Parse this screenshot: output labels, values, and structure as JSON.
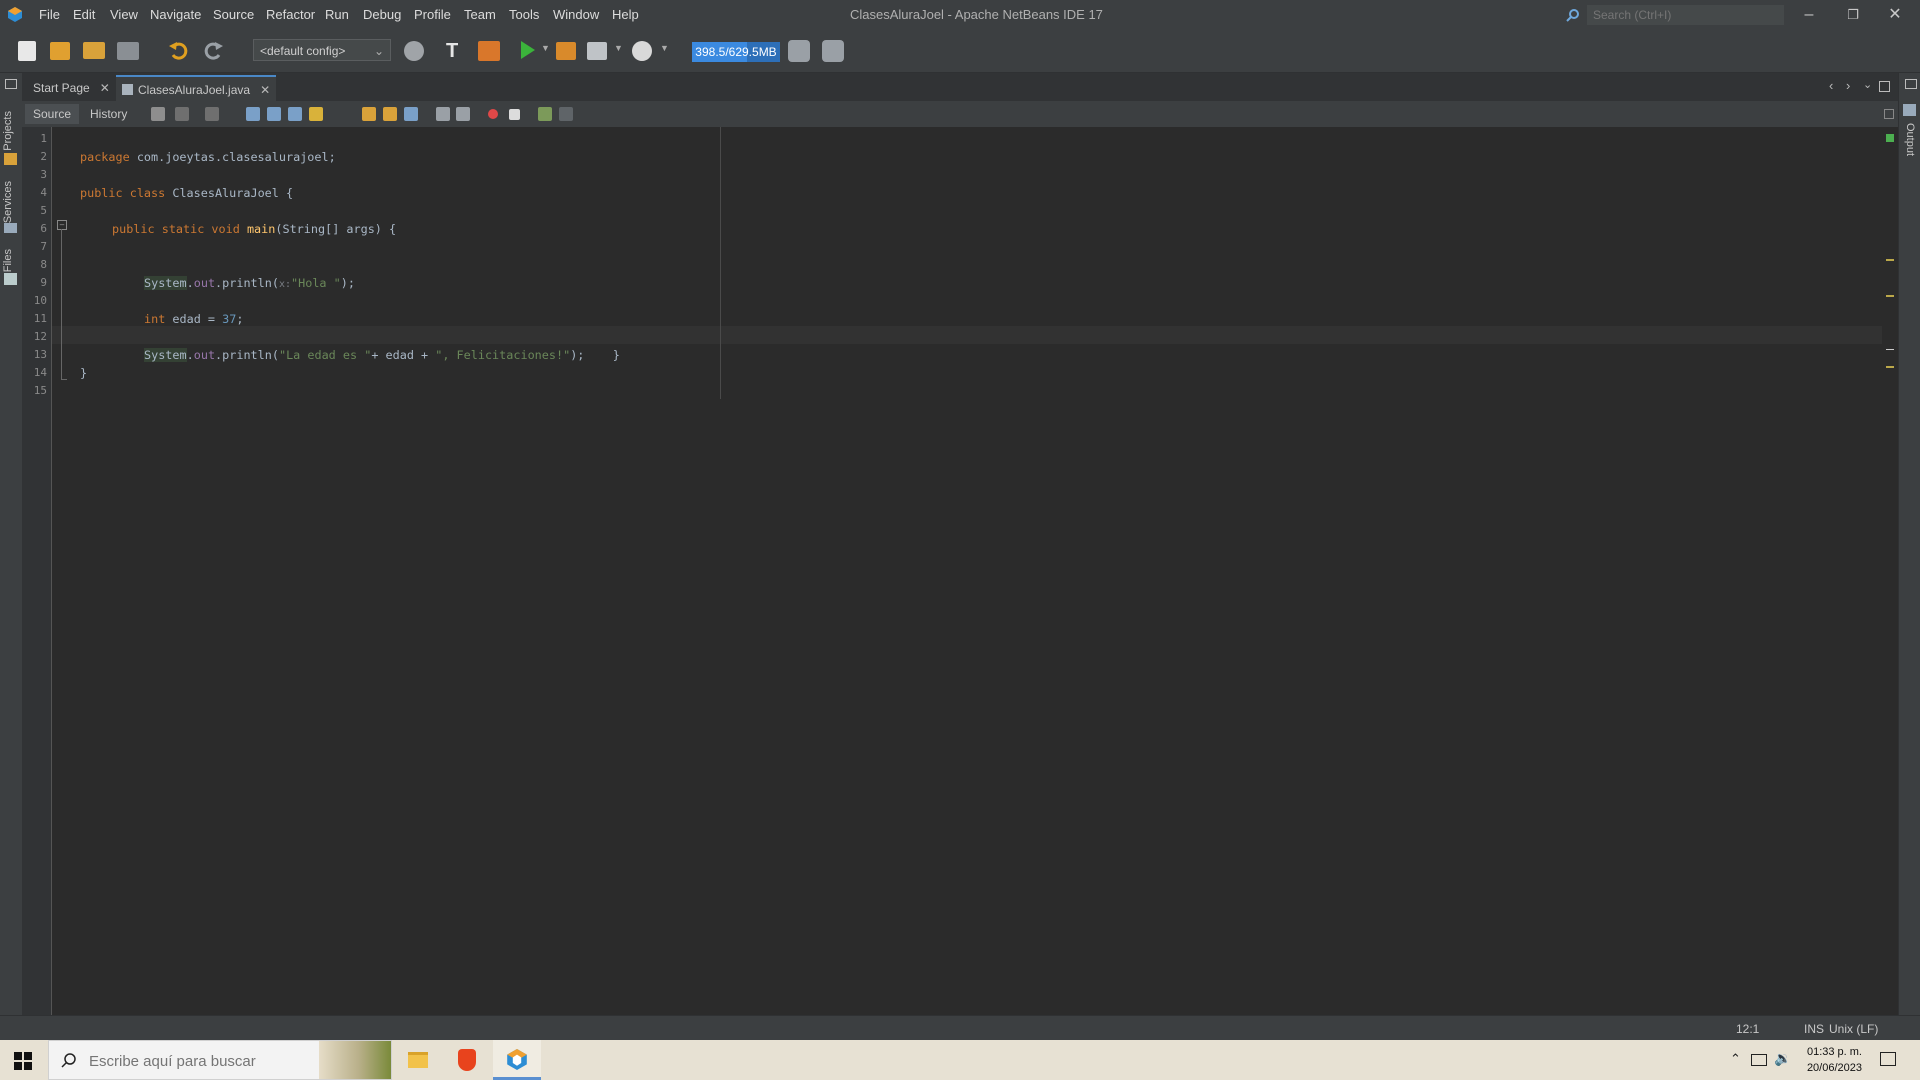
{
  "menubar": {
    "items": [
      "File",
      "Edit",
      "View",
      "Navigate",
      "Source",
      "Refactor",
      "Run",
      "Debug",
      "Profile",
      "Team",
      "Tools",
      "Window",
      "Help"
    ],
    "window_title": "ClasesAluraJoel - Apache NetBeans IDE 17",
    "search_placeholder": "Search (Ctrl+I)"
  },
  "toolbar": {
    "config": "<default config>",
    "memory": "398.5/629.5MB",
    "memory_fraction": 0.63
  },
  "side_panels": {
    "left": [
      "Projects",
      "Services",
      "Files"
    ],
    "right": [
      "Output"
    ]
  },
  "tabs": [
    {
      "label": "Start Page",
      "active": false
    },
    {
      "label": "ClasesAluraJoel.java",
      "active": true
    }
  ],
  "editor_toolbar": {
    "source_label": "Source",
    "history_label": "History"
  },
  "editor": {
    "line_numbers": [
      "1",
      "2",
      "3",
      "4",
      "5",
      "6",
      "7",
      "8",
      "9",
      "10",
      "11",
      "12",
      "13",
      "14",
      "15"
    ],
    "line2_kw": "package",
    "line2_rest": " com.joeytas.clasesalurajoel;",
    "line4_kw": "public class",
    "line4_rest": " ClasesAluraJoel {",
    "line6_kw": "public static void",
    "line6_fn": "main",
    "line6_rest": "(String[] args) {",
    "line9_cls": "System",
    "line9_dot": ".",
    "line9_field": "out",
    "line9_call": ".println(",
    "line9_hint": "x:",
    "line9_str": "\"Hola \"",
    "line9_end": ");",
    "line11_kw": "int",
    "line11_mid": " edad = ",
    "line11_num": "37",
    "line11_end": ";",
    "line13_cls": "System",
    "line13_dot": ".",
    "line13_field": "out",
    "line13_call": ".println(",
    "line13_str1": "\"La edad es \"",
    "line13_mid": "+ edad + ",
    "line13_str2": "\", Felicitaciones!\"",
    "line13_end": ");    }",
    "line14": "}"
  },
  "statusbar": {
    "position": "12:1",
    "mode": "INS",
    "line_ending": "Unix (LF)"
  },
  "taskbar": {
    "search_placeholder": "Escribe aquí para buscar",
    "time": "01:33 p. m.",
    "date": "20/06/2023"
  }
}
